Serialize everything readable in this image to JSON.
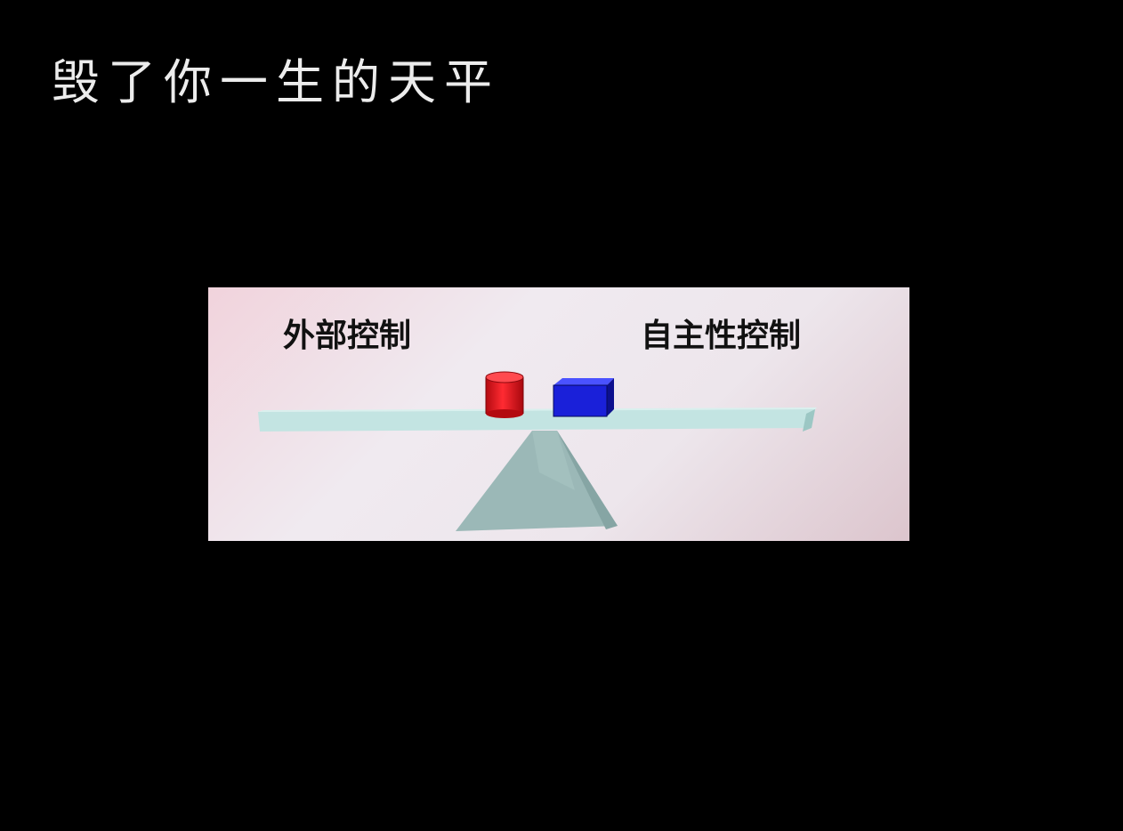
{
  "slide": {
    "title": "毁了你一生的天平"
  },
  "diagram": {
    "left_label": "外部控制",
    "right_label": "自主性控制",
    "colors": {
      "panel_background": "#efe3ea",
      "beam": "#bfe3e1",
      "fulcrum": "#9bb8b7",
      "left_weight": "#e8151f",
      "right_weight": "#1a20d9"
    },
    "icons": {
      "left_weight": "red-cylinder-icon",
      "right_weight": "blue-box-icon"
    }
  }
}
